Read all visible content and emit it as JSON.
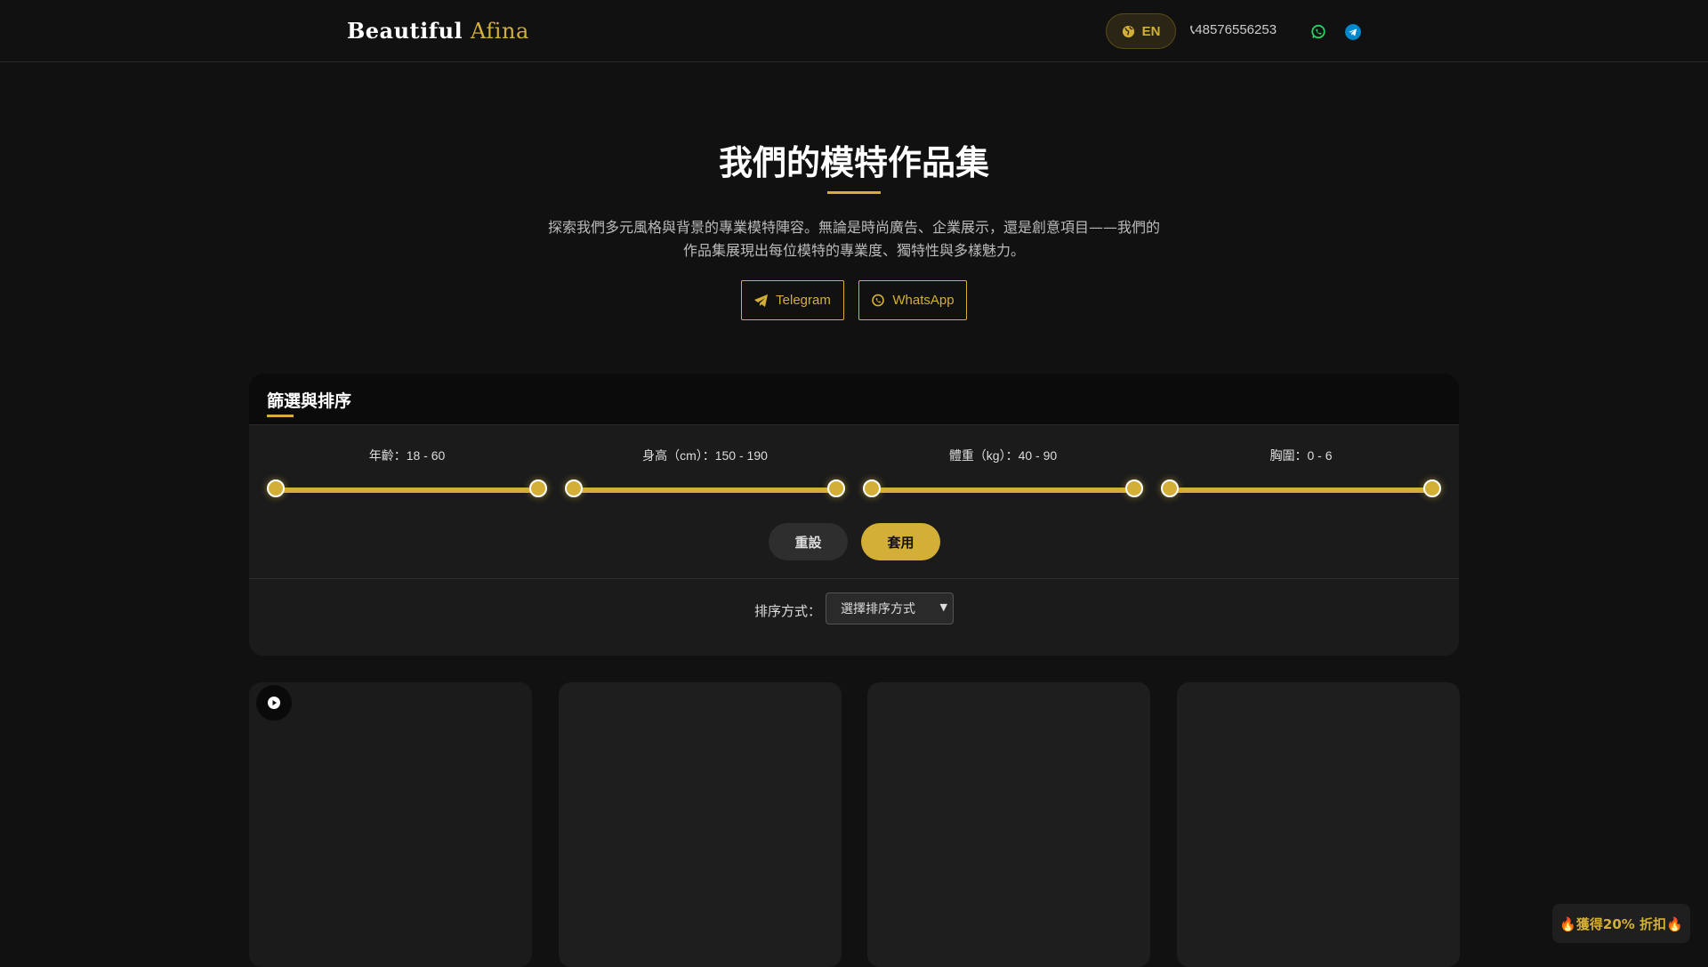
{
  "header": {
    "logo_main": "Beautiful",
    "logo_accent": "Afina",
    "lang": "EN",
    "phone": "48576556253"
  },
  "hero": {
    "title": "我們的模特作品集",
    "description": "探索我們多元風格與背景的專業模特陣容。無論是時尚廣告、企業展示，還是創意項目——我們的作品集展現出每位模特的專業度、獨特性與多樣魅力。",
    "telegram": "Telegram",
    "whatsapp": "WhatsApp"
  },
  "filters": {
    "title": "篩選與排序",
    "items": [
      {
        "label": "年齡：18 - 60",
        "min": 18,
        "max": 60
      },
      {
        "label": "身高（cm）：150 - 190",
        "min": 150,
        "max": 190
      },
      {
        "label": "體重（kg）：40 - 90",
        "min": 40,
        "max": 90
      },
      {
        "label": "胸圍：0 - 6",
        "min": 0,
        "max": 6
      }
    ],
    "reset": "重設",
    "apply": "套用",
    "sort_label": "排序方式：",
    "sort_value": "選擇排序方式"
  },
  "promo": "🔥獲得20% 折扣🔥",
  "colors": {
    "accent": "#d4af37",
    "whatsapp": "#25d366",
    "telegram": "#0088cc"
  }
}
